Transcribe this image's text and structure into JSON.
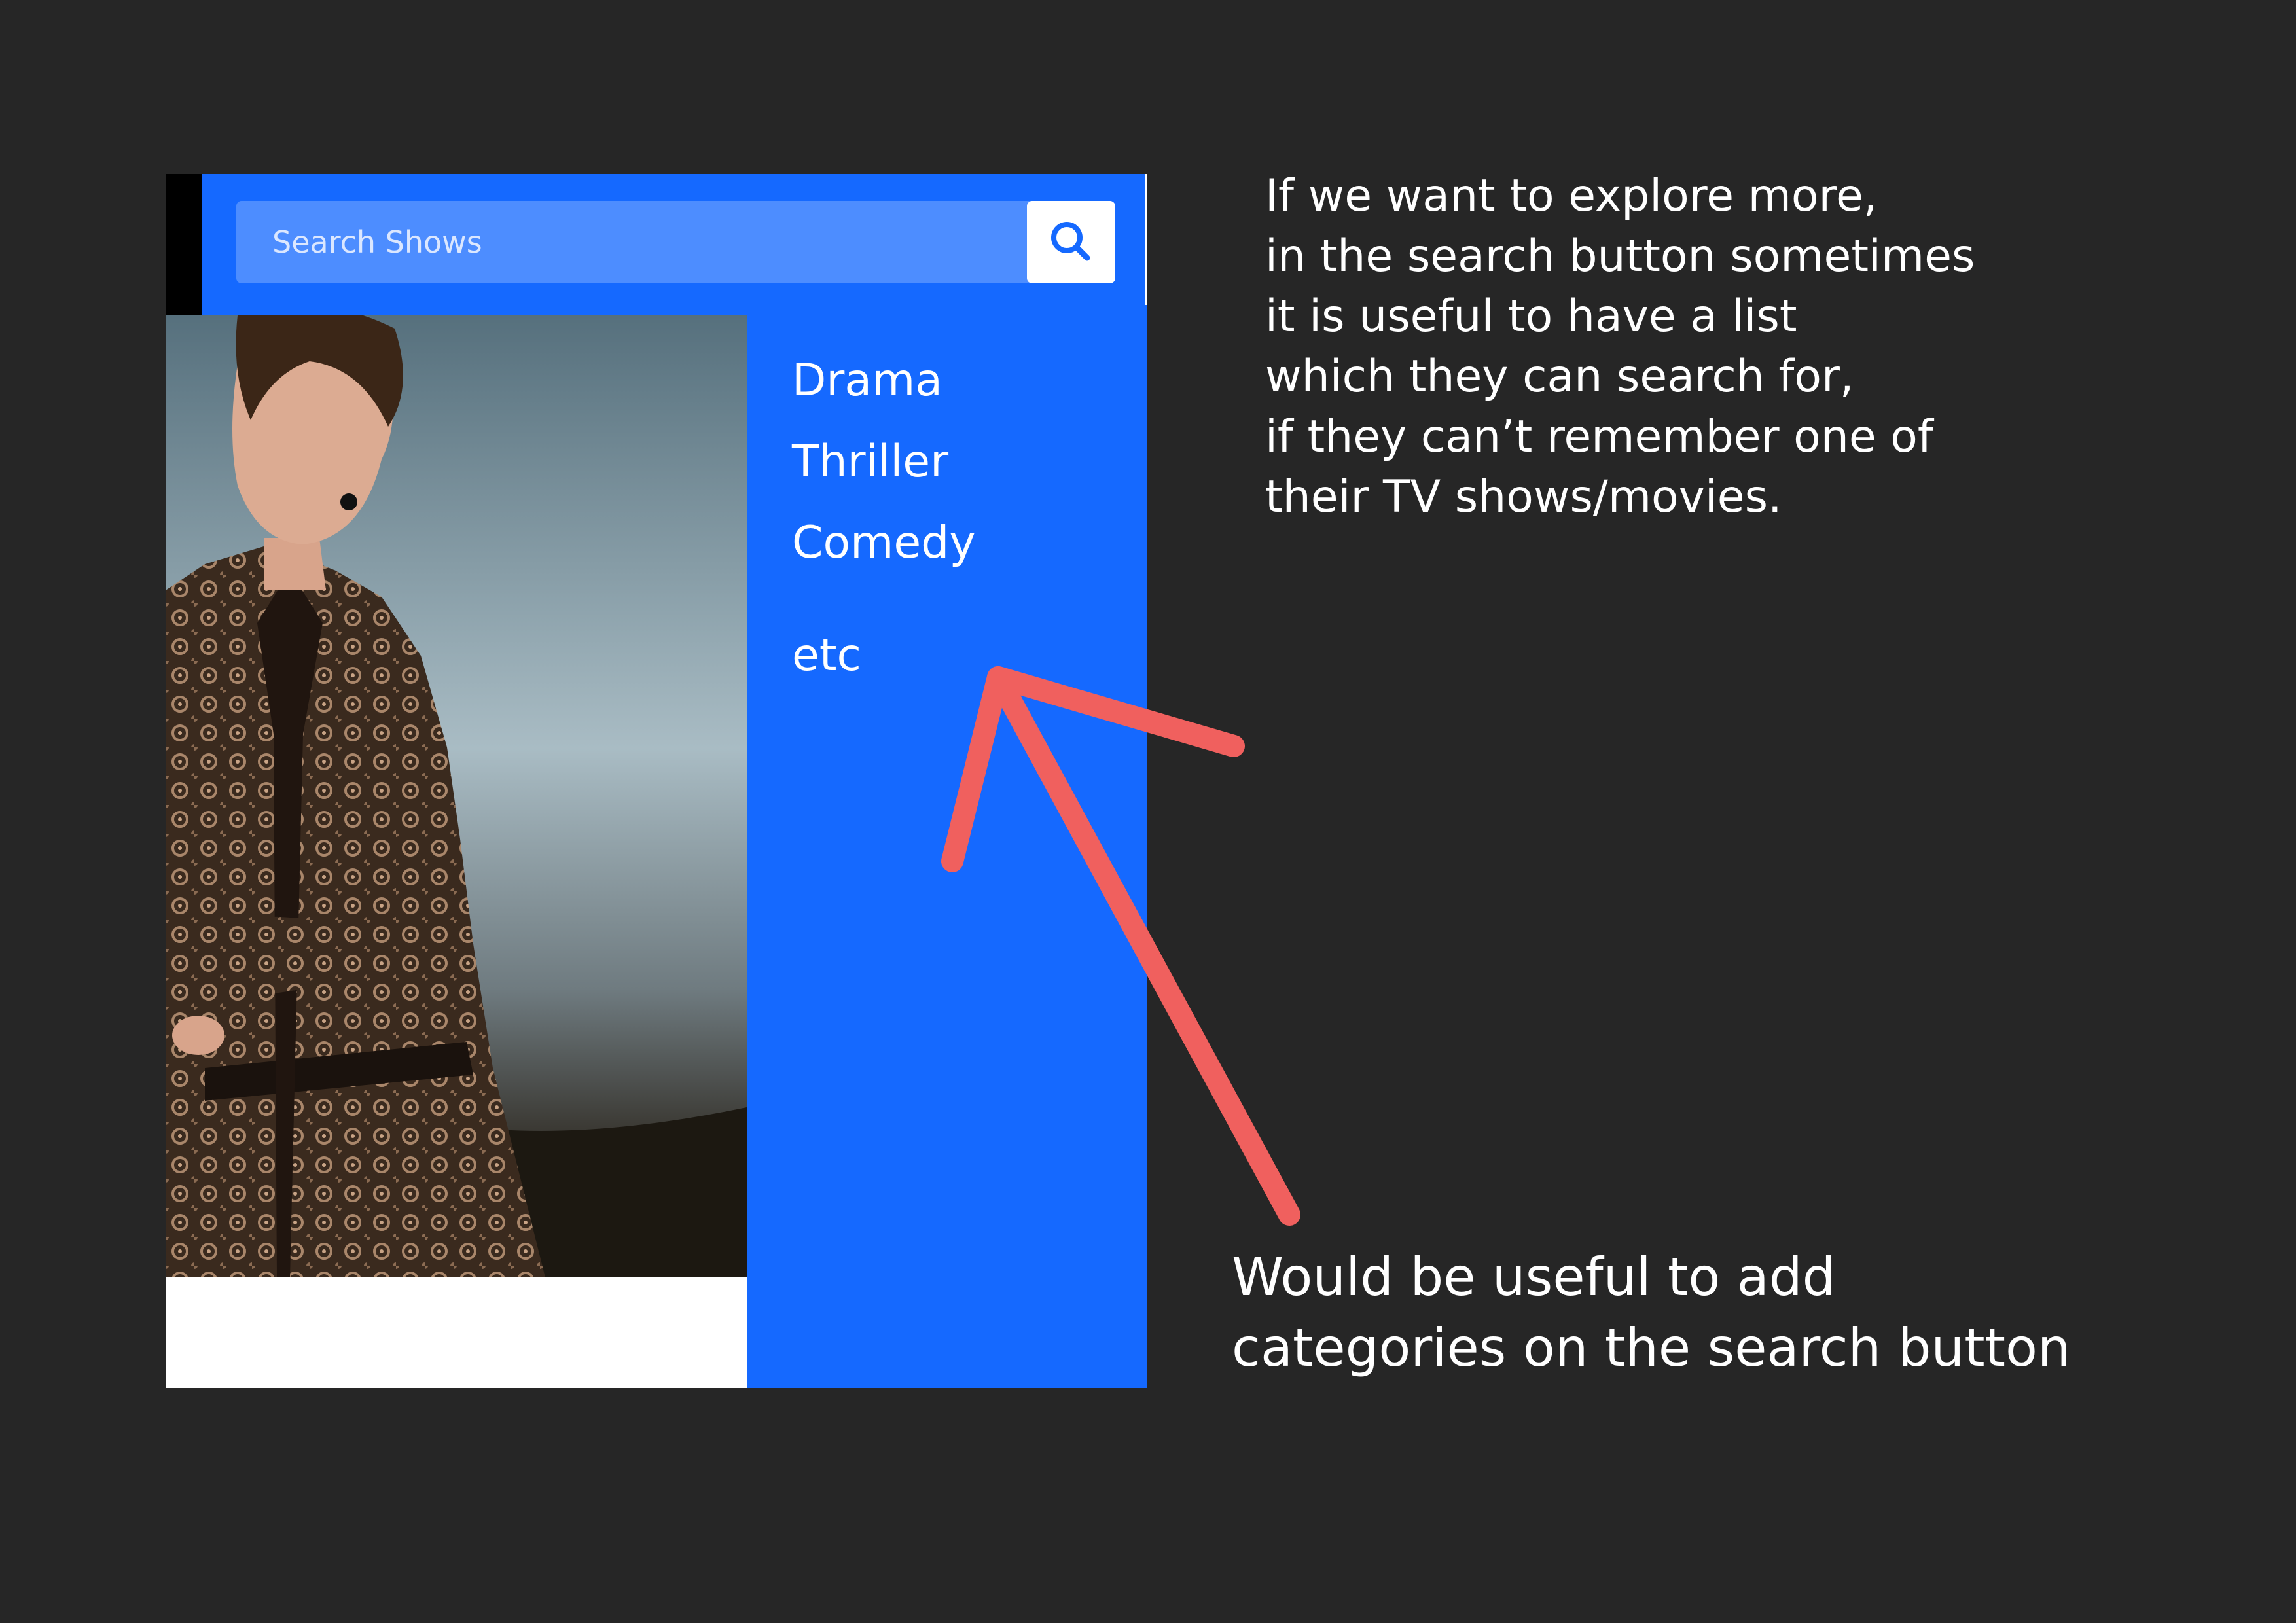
{
  "search": {
    "placeholder": "Search Shows",
    "button_icon": "search-icon"
  },
  "genres": [
    {
      "label": "Drama"
    },
    {
      "label": "Thriller"
    },
    {
      "label": "Comedy"
    },
    {
      "label": "etc"
    }
  ],
  "annotations": {
    "top_note": [
      "If we want to explore more,",
      "in the search button sometimes",
      "it is useful to have a list",
      "which they can search for,",
      "if they can’t remember one of",
      "their TV shows/movies."
    ],
    "bottom_note": [
      "Would be useful to add",
      "categories on the search button"
    ]
  },
  "colors": {
    "background": "#262626",
    "accent_blue": "#1569ff",
    "search_field": "#4d8dff",
    "arrow": "#f0605e"
  }
}
